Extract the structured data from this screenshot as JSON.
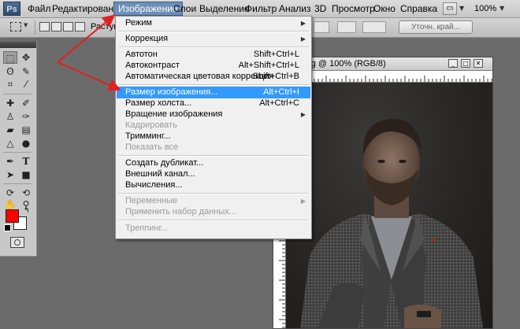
{
  "app": {
    "logo": "Ps"
  },
  "menubar": {
    "items": [
      "Файл",
      "Редактирование",
      "Изображение",
      "Слои",
      "Выделение",
      "Фильтр",
      "Анализ",
      "3D",
      "Просмотр",
      "Окно",
      "Справка"
    ],
    "zoom": "100%"
  },
  "options": {
    "feather_label": "Растуш",
    "refine_edge": "Уточн. край..."
  },
  "document": {
    "title": "d.jpg @ 100% (RGB/8)"
  },
  "image_menu": {
    "items": [
      {
        "label": "Режим",
        "shortcut": "",
        "submenu": true,
        "disabled": false
      },
      {
        "label": "Коррекция",
        "shortcut": "",
        "submenu": true,
        "disabled": false
      },
      {
        "label": "Автотон",
        "shortcut": "Shift+Ctrl+L",
        "submenu": false,
        "disabled": false
      },
      {
        "label": "Автоконтраст",
        "shortcut": "Alt+Shift+Ctrl+L",
        "submenu": false,
        "disabled": false
      },
      {
        "label": "Автоматическая цветовая коррекция",
        "shortcut": "Shift+Ctrl+B",
        "submenu": false,
        "disabled": false
      },
      {
        "label": "Размер изображения...",
        "shortcut": "Alt+Ctrl+I",
        "submenu": false,
        "disabled": false,
        "highlighted": true
      },
      {
        "label": "Размер холста...",
        "shortcut": "Alt+Ctrl+C",
        "submenu": false,
        "disabled": false
      },
      {
        "label": "Вращение изображения",
        "shortcut": "",
        "submenu": true,
        "disabled": false
      },
      {
        "label": "Кадрировать",
        "shortcut": "",
        "submenu": false,
        "disabled": true
      },
      {
        "label": "Тримминг...",
        "shortcut": "",
        "submenu": false,
        "disabled": false
      },
      {
        "label": "Показать все",
        "shortcut": "",
        "submenu": false,
        "disabled": true
      },
      {
        "label": "Создать дубликат...",
        "shortcut": "",
        "submenu": false,
        "disabled": false
      },
      {
        "label": "Внешний канал...",
        "shortcut": "",
        "submenu": false,
        "disabled": false
      },
      {
        "label": "Вычисления...",
        "shortcut": "",
        "submenu": false,
        "disabled": false
      },
      {
        "label": "Переменные",
        "shortcut": "",
        "submenu": true,
        "disabled": true
      },
      {
        "label": "Применить набор данных...",
        "shortcut": "",
        "submenu": false,
        "disabled": true
      },
      {
        "label": "Треппинг...",
        "shortcut": "",
        "submenu": false,
        "disabled": true
      }
    ]
  },
  "colors": {
    "foreground": "#ff0000",
    "background": "#ffffff",
    "menu_highlight": "#3399ff",
    "annotation_arrow": "#e02020"
  }
}
